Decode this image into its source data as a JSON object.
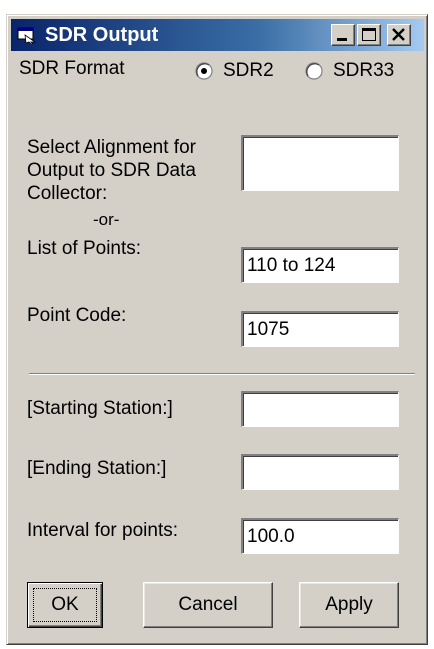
{
  "window": {
    "title": "SDR Output",
    "icon": "app-window-icon"
  },
  "titlebar_buttons": {
    "minimize": "minimize-icon",
    "maximize": "maximize-icon",
    "close": "close-icon"
  },
  "format": {
    "label": "SDR Format",
    "options": [
      {
        "label": "SDR2",
        "selected": true
      },
      {
        "label": "SDR33",
        "selected": false
      }
    ]
  },
  "alignment": {
    "label_line1": "Select Alignment for",
    "label_line2": "Output to SDR Data",
    "label_line3": "Collector:",
    "value": ""
  },
  "or_label": "-or-",
  "points": {
    "label": "List of Points:",
    "value": "110 to 124"
  },
  "point_code": {
    "label": "Point Code:",
    "value": "1075"
  },
  "starting_station": {
    "label": "[Starting Station:]",
    "value": ""
  },
  "ending_station": {
    "label": "[Ending Station:]",
    "value": ""
  },
  "interval": {
    "label": "Interval for points:",
    "value": "100.0"
  },
  "buttons": {
    "ok": "OK",
    "cancel": "Cancel",
    "apply": "Apply"
  },
  "colors": {
    "titlebar_start": "#0a246a",
    "titlebar_end": "#a6caf0",
    "face": "#d4d0c8"
  }
}
